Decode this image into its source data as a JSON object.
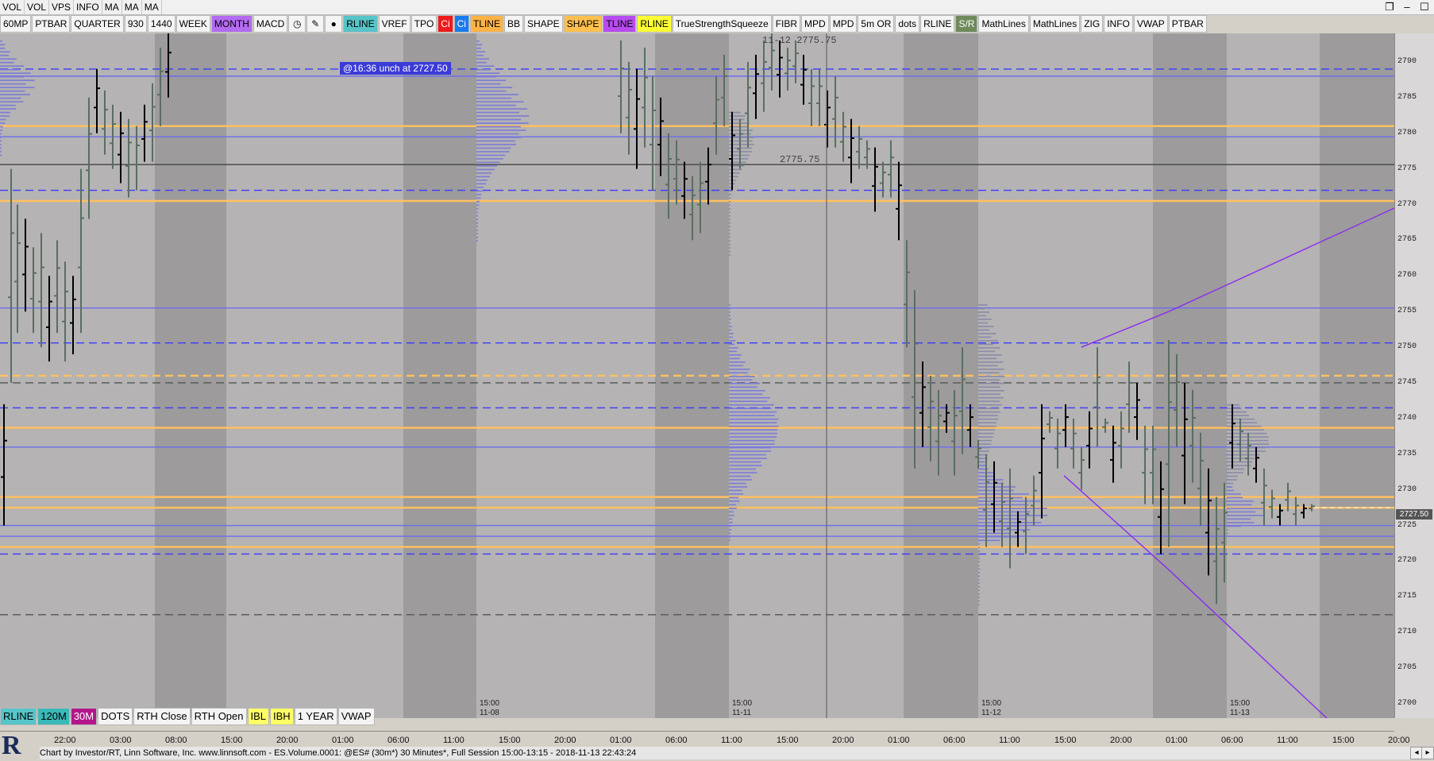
{
  "menu": [
    "VOL",
    "VOL",
    "VPS",
    "INFO",
    "MA",
    "MA",
    "MA"
  ],
  "toolbar": [
    {
      "label": "60MP",
      "bg": "#f4f4f4"
    },
    {
      "label": "PTBAR",
      "bg": "#f4f4f4"
    },
    {
      "label": "QUARTER",
      "bg": "#f4f4f4"
    },
    {
      "label": "930",
      "bg": "#f4f4f4"
    },
    {
      "label": "1440",
      "bg": "#f4f4f4"
    },
    {
      "label": "WEEK",
      "bg": "#f4f4f4"
    },
    {
      "label": "MONTH",
      "bg": "#b36bf2"
    },
    {
      "label": "MACD",
      "bg": "#f4f4f4"
    },
    {
      "label": "◷",
      "bg": "#f4f4f4",
      "icon": "clock-icon"
    },
    {
      "label": "✎",
      "bg": "#f4f4f4",
      "icon": "pencil-icon"
    },
    {
      "label": "●",
      "bg": "#f4f4f4",
      "icon": "record-icon"
    },
    {
      "label": "RLINE",
      "bg": "#57c4c8"
    },
    {
      "label": "VREF",
      "bg": "#f4f4f4"
    },
    {
      "label": "TPO",
      "bg": "#f4f4f4"
    },
    {
      "label": "Ci",
      "bg": "#f01a1a"
    },
    {
      "label": "Ci",
      "bg": "#1a7af0"
    },
    {
      "label": "TLINE",
      "bg": "#ffb347"
    },
    {
      "label": "BB",
      "bg": "#f4f4f4"
    },
    {
      "label": "SHAPE",
      "bg": "#f4f4f4"
    },
    {
      "label": "SHAPE",
      "bg": "#ffc04d"
    },
    {
      "label": "TLINE",
      "bg": "#b64cf0"
    },
    {
      "label": "RLINE",
      "bg": "#ffff33"
    },
    {
      "label": "TrueStrengthSqueeze",
      "bg": "#f4f4f4"
    },
    {
      "label": "FIBR",
      "bg": "#f4f4f4"
    },
    {
      "label": "MPD",
      "bg": "#f4f4f4"
    },
    {
      "label": "MPD",
      "bg": "#f4f4f4"
    },
    {
      "label": "5m OR",
      "bg": "#f4f4f4"
    },
    {
      "label": "dots",
      "bg": "#f4f4f4"
    },
    {
      "label": "RLINE",
      "bg": "#f4f4f4"
    },
    {
      "label": "S/R",
      "bg": "#6e8a5a"
    },
    {
      "label": "MathLines",
      "bg": "#f4f4f4"
    },
    {
      "label": "MathLines",
      "bg": "#f4f4f4"
    },
    {
      "label": "ZIG",
      "bg": "#f4f4f4"
    },
    {
      "label": "INFO",
      "bg": "#f4f4f4"
    },
    {
      "label": "VWAP",
      "bg": "#f4f4f4"
    },
    {
      "label": "PTBAR",
      "bg": "#f4f4f4"
    }
  ],
  "bottom_toolbar": [
    {
      "label": "RLINE",
      "bg": "#57c4c8"
    },
    {
      "label": "120M",
      "bg": "#3bb8b8"
    },
    {
      "label": "30M",
      "bg": "#b3168a"
    },
    {
      "label": "DOTS",
      "bg": "#f4f4f4"
    },
    {
      "label": "RTH Close",
      "bg": "#f4f4f4"
    },
    {
      "label": "RTH Open",
      "bg": "#f4f4f4"
    },
    {
      "label": "IBL",
      "bg": "#ffff66"
    },
    {
      "label": "IBH",
      "bg": "#ffff66"
    },
    {
      "label": "1 YEAR",
      "bg": "#f4f4f4"
    },
    {
      "label": "VWAP",
      "bg": "#f4f4f4"
    }
  ],
  "y_axis": [
    "2790",
    "2785",
    "2780",
    "2775",
    "2770",
    "2765",
    "2760",
    "2755",
    "2750",
    "2745",
    "2740",
    "2735",
    "2730",
    "2725",
    "2720",
    "2715",
    "2710",
    "2705",
    "2700"
  ],
  "x_axis": [
    "22:00",
    "03:00",
    "08:00",
    "15:00",
    "20:00",
    "01:00",
    "06:00",
    "11:00",
    "15:00",
    "20:00",
    "01:00",
    "06:00",
    "11:00",
    "15:00",
    "20:00",
    "01:00",
    "06:00",
    "11:00",
    "15:00",
    "20:00",
    "01:00",
    "06:00",
    "11:00",
    "15:00",
    "20:00"
  ],
  "session_labels": [
    {
      "time": "15:00",
      "date": "11-08"
    },
    {
      "time": "15:00",
      "date": "11-11"
    },
    {
      "time": "15:00",
      "date": "11-12"
    },
    {
      "time": "15:00",
      "date": "11-13"
    }
  ],
  "price_marker": "2727.50",
  "note": "@16:36  unch at 2727.50",
  "price_label": "2775.75",
  "top_label": "11-12 2775.75",
  "status": "Chart by Investor/RT, Linn Software, Inc. www.linnsoft.com - ES.Volume.0001: @ES# (30m*) 30 Minutes*, Full Session 15:00-13:15 - 2018-11-13 22:43:24",
  "chart_data": {
    "type": "candlestick",
    "y_range": [
      2698,
      2794
    ],
    "levels": [
      {
        "price": 2789,
        "color": "#3a3aff",
        "style": "dashed"
      },
      {
        "price": 2788,
        "color": "#6c6cf0",
        "style": "solid"
      },
      {
        "price": 2781,
        "color": "#ffc060",
        "style": "solid"
      },
      {
        "price": 2779.5,
        "color": "#6c6cf0",
        "style": "solid"
      },
      {
        "price": 2775.6,
        "color": "#444444",
        "style": "solid"
      },
      {
        "price": 2772,
        "color": "#3a3aff",
        "style": "dashed"
      },
      {
        "price": 2770.5,
        "color": "#ffc060",
        "style": "solid"
      },
      {
        "price": 2755.5,
        "color": "#6c6cf0",
        "style": "solid"
      },
      {
        "price": 2750.6,
        "color": "#3a3aff",
        "style": "dashed"
      },
      {
        "price": 2746,
        "color": "#ffc060",
        "style": "dashed"
      },
      {
        "price": 2745,
        "color": "#555555",
        "style": "dashed"
      },
      {
        "price": 2741.5,
        "color": "#3a3aff",
        "style": "dashed"
      },
      {
        "price": 2738.7,
        "color": "#ffc060",
        "style": "solid"
      },
      {
        "price": 2736,
        "color": "#6c6cf0",
        "style": "solid"
      },
      {
        "price": 2729,
        "color": "#ffc060",
        "style": "solid"
      },
      {
        "price": 2727.5,
        "color": "#ffc060",
        "style": "solid"
      },
      {
        "price": 2725,
        "color": "#6c6cf0",
        "style": "solid"
      },
      {
        "price": 2723.5,
        "color": "#6c6cf0",
        "style": "solid"
      },
      {
        "price": 2722,
        "color": "#ffc060",
        "style": "solid"
      },
      {
        "price": 2721,
        "color": "#3a3aff",
        "style": "dashed"
      },
      {
        "price": 2712.5,
        "color": "#555555",
        "style": "dashed"
      }
    ]
  }
}
